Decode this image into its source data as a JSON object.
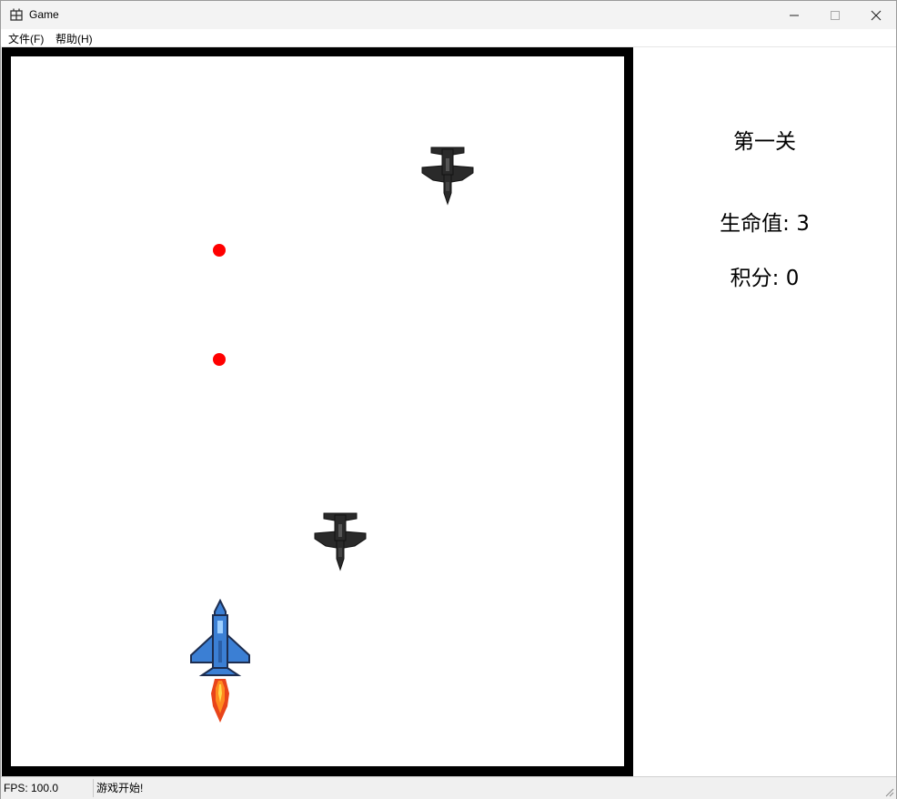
{
  "window": {
    "title": "Game",
    "icon": "app-grid-icon",
    "controls": [
      "minimize-icon",
      "maximize-icon",
      "close-icon"
    ]
  },
  "menu": {
    "file": "文件(F)",
    "help": "帮助(H)"
  },
  "game": {
    "player_sprite": "blue-fighter-jet",
    "enemy_sprite": "black-fighter-jet",
    "enemy_count": 2,
    "bullet_color": "#ff0000",
    "bullet_count": 2
  },
  "panel": {
    "level": "第一关",
    "lives": "生命值: 3",
    "score": "积分: 0"
  },
  "status": {
    "fps": "FPS: 100.0",
    "message": "游戏开始!"
  },
  "colors": {
    "frame": "#000000",
    "player": "#3b7fd4",
    "enemy": "#2a2a2a",
    "flame": "#ff8a1f"
  }
}
